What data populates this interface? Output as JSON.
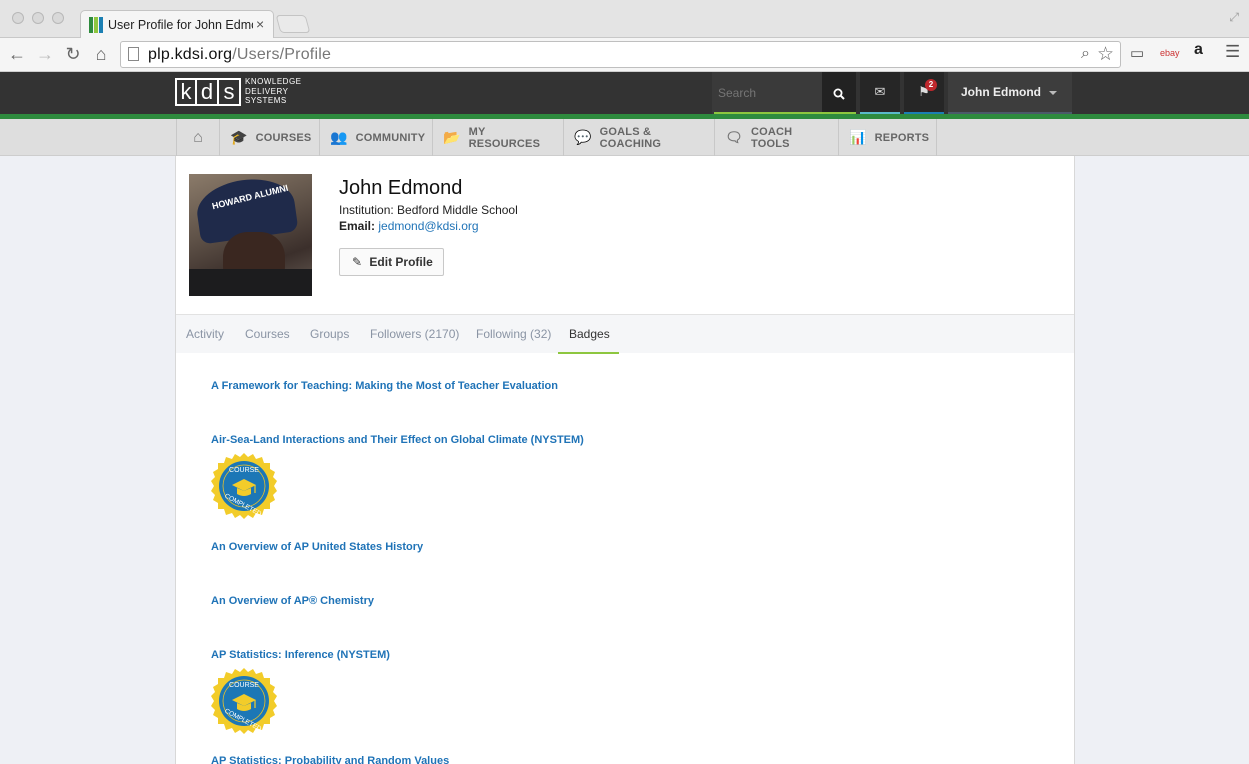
{
  "browser": {
    "tab_title": "User Profile for John Edmond",
    "url_host": "plp.kdsi.org",
    "url_path": "/Users/Profile",
    "extensions": [
      "ebay",
      "a"
    ]
  },
  "site": {
    "logo_letters": [
      "k",
      "d",
      "s"
    ],
    "logo_text": [
      "KNOWLEDGE",
      "DELIVERY",
      "SYSTEMS"
    ],
    "search_placeholder": "Search",
    "notification_count": "2",
    "user_name": "John Edmond",
    "colors": {
      "header": "#333333",
      "accent_green": "#2e8b3e",
      "search_underline": "#8dc63f",
      "mail_underline": "#5ab9c9",
      "flag_underline": "#1b7fb3",
      "link": "#1f73b7"
    }
  },
  "nav": {
    "items": [
      {
        "icon": "home-icon",
        "label": ""
      },
      {
        "icon": "graduation-cap-icon",
        "label": "COURSES"
      },
      {
        "icon": "users-icon",
        "label": "COMMUNITY"
      },
      {
        "icon": "folder-icon",
        "label": "MY RESOURCES"
      },
      {
        "icon": "comments-icon",
        "label": "GOALS & COACHING"
      },
      {
        "icon": "comment-icon",
        "label": "COACH TOOLS"
      },
      {
        "icon": "bar-chart-icon",
        "label": "REPORTS"
      }
    ]
  },
  "profile": {
    "name": "John Edmond",
    "institution": "Institution: Bedford Middle School",
    "email_label": "Email:",
    "email": "jedmond@kdsi.org",
    "edit_label": "Edit Profile",
    "avatar_cap_text": "HOWARD ALUMNI"
  },
  "tabs": [
    {
      "label": "Activity",
      "active": false
    },
    {
      "label": "Courses",
      "active": false
    },
    {
      "label": "Groups",
      "active": false
    },
    {
      "label": "Followers (2170)",
      "active": false
    },
    {
      "label": "Following (32)",
      "active": false
    },
    {
      "label": "Badges",
      "active": true
    }
  ],
  "badges": [
    {
      "course": "A Framework for Teaching: Making the Most of Teacher Evaluation",
      "completed": false
    },
    {
      "course": "Air-Sea-Land Interactions and Their Effect on Global Climate (NYSTEM)",
      "completed": true
    },
    {
      "course": "An Overview of AP United States History",
      "completed": false
    },
    {
      "course": "An Overview of AP® Chemistry",
      "completed": false
    },
    {
      "course": "AP Statistics: Inference (NYSTEM)",
      "completed": true
    },
    {
      "course": "AP Statistics: Probability and Random Values",
      "completed": false
    }
  ],
  "seal": {
    "top_text": "COURSE",
    "bottom_text": "COMPLETED"
  }
}
